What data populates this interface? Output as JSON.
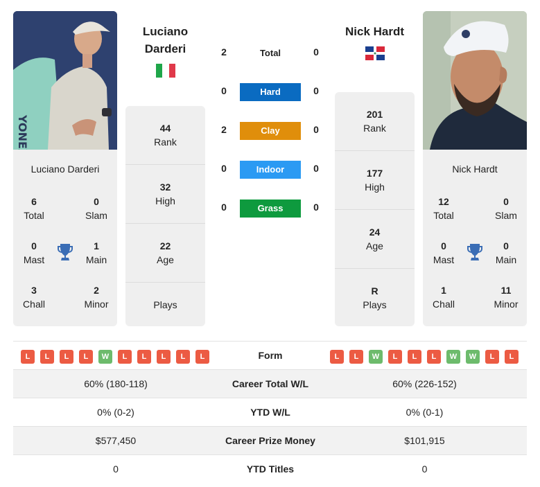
{
  "player1": {
    "name_head_line1": "Luciano",
    "name_head_line2": "Darderi",
    "name": "Luciano Darderi",
    "country_flag": "italy-flag",
    "titles": {
      "total": {
        "value": "6",
        "label": "Total"
      },
      "slam": {
        "value": "0",
        "label": "Slam"
      },
      "mast": {
        "value": "0",
        "label": "Mast"
      },
      "main": {
        "value": "1",
        "label": "Main"
      },
      "chall": {
        "value": "3",
        "label": "Chall"
      },
      "minor": {
        "value": "2",
        "label": "Minor"
      }
    },
    "rank": {
      "value": "44",
      "label": "Rank"
    },
    "high": {
      "value": "32",
      "label": "High"
    },
    "age": {
      "value": "22",
      "label": "Age"
    },
    "plays": {
      "value": "",
      "label": "Plays"
    },
    "form": [
      "L",
      "L",
      "L",
      "L",
      "W",
      "L",
      "L",
      "L",
      "L",
      "L"
    ]
  },
  "player2": {
    "name_head": "Nick Hardt",
    "name": "Nick Hardt",
    "country_flag": "dominican-republic-flag",
    "titles": {
      "total": {
        "value": "12",
        "label": "Total"
      },
      "slam": {
        "value": "0",
        "label": "Slam"
      },
      "mast": {
        "value": "0",
        "label": "Mast"
      },
      "main": {
        "value": "0",
        "label": "Main"
      },
      "chall": {
        "value": "1",
        "label": "Chall"
      },
      "minor": {
        "value": "11",
        "label": "Minor"
      }
    },
    "rank": {
      "value": "201",
      "label": "Rank"
    },
    "high": {
      "value": "177",
      "label": "High"
    },
    "age": {
      "value": "24",
      "label": "Age"
    },
    "plays": {
      "value": "R",
      "label": "Plays"
    },
    "form": [
      "L",
      "L",
      "W",
      "L",
      "L",
      "L",
      "W",
      "W",
      "L",
      "L"
    ]
  },
  "h2h": {
    "total": {
      "label": "Total",
      "p1": "2",
      "p2": "0"
    },
    "surfaces": [
      {
        "label": "Hard",
        "p1": "0",
        "p2": "0",
        "color": "#0a6bc1"
      },
      {
        "label": "Clay",
        "p1": "2",
        "p2": "0",
        "color": "#e08e0b"
      },
      {
        "label": "Indoor",
        "p1": "0",
        "p2": "0",
        "color": "#2b9af3"
      },
      {
        "label": "Grass",
        "p1": "0",
        "p2": "0",
        "color": "#0e9a3e"
      }
    ]
  },
  "table": {
    "form_label": "Form",
    "rows": [
      {
        "label": "Career Total W/L",
        "p1": "60% (180-118)",
        "p2": "60% (226-152)"
      },
      {
        "label": "YTD W/L",
        "p1": "0% (0-2)",
        "p2": "0% (0-1)"
      },
      {
        "label": "Career Prize Money",
        "p1": "$577,450",
        "p2": "$101,915"
      },
      {
        "label": "YTD Titles",
        "p1": "0",
        "p2": "0"
      }
    ]
  },
  "colors": {
    "loss": "#ec5b43",
    "win": "#6dbb6c",
    "trophy": "#3a6db5"
  }
}
